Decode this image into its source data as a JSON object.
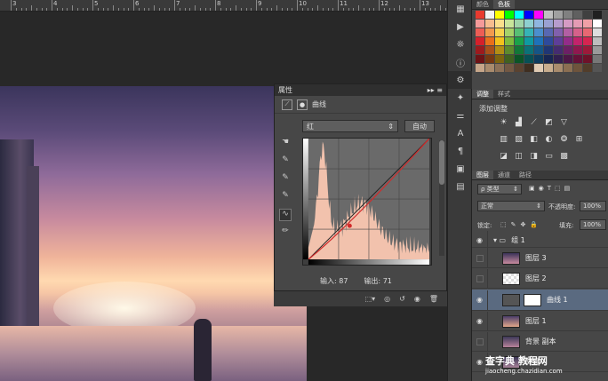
{
  "ruler": {
    "numbers": [
      "3",
      "4",
      "5",
      "6",
      "7",
      "8",
      "9",
      "10",
      "11",
      "12",
      "13"
    ]
  },
  "properties_panel": {
    "title": "属性",
    "subtitle": "曲线",
    "preset_value": "红",
    "auto_label": "自动",
    "input_label": "输入:",
    "input_value": "87",
    "output_label": "输出:",
    "output_value": "71"
  },
  "curve": {
    "channel_color": "#d22a2a",
    "point": {
      "input": 87,
      "output": 71
    }
  },
  "swatch_panel": {
    "tabs": [
      "颜色",
      "色板"
    ],
    "active_tab": "色板",
    "colors": [
      "#e83a2f",
      "#f2f2f2",
      "#ffff00",
      "#00ff00",
      "#00ffff",
      "#0000ff",
      "#ff00ff",
      "#c0c0c0",
      "#a0a0a0",
      "#808080",
      "#606060",
      "#404040",
      "#202020",
      "#f59a9a",
      "#f7bd8f",
      "#fbe08c",
      "#c9e59a",
      "#9fd3a9",
      "#8ecfd0",
      "#8fb6e0",
      "#9aa1d2",
      "#b79ccd",
      "#d59bc4",
      "#e59bb4",
      "#f0a0a6",
      "#ffffff",
      "#ed5d55",
      "#f29a4e",
      "#f9d44f",
      "#a6d26a",
      "#57bf74",
      "#36b3b6",
      "#4b8fcd",
      "#5868b2",
      "#8160ad",
      "#b25fa3",
      "#d6618a",
      "#e96872",
      "#dedede",
      "#d5202b",
      "#e96f1b",
      "#f4c21c",
      "#7fbb3e",
      "#1aa24a",
      "#0f9aa1",
      "#1e72b9",
      "#2e4a9b",
      "#5e3e98",
      "#932c89",
      "#c2236b",
      "#d62550",
      "#bdbdbd",
      "#9d1a1e",
      "#a9501a",
      "#b38e15",
      "#5d8a2d",
      "#127738",
      "#0b7278",
      "#155586",
      "#203674",
      "#452c70",
      "#6c2065",
      "#8f184f",
      "#9d1a3a",
      "#9a9a9a",
      "#6e1316",
      "#773812",
      "#7e640f",
      "#416120",
      "#0c5427",
      "#075055",
      "#0e3c5f",
      "#172653",
      "#311f50",
      "#4d1747",
      "#651138",
      "#6e1229",
      "#777777",
      "#c6a68a",
      "#a98b6d",
      "#8d7158",
      "#735843",
      "#5a4230",
      "#3f2e20",
      "#e0cbb3",
      "#c8ad8e",
      "#a98c6d",
      "#8b6f52",
      "#6e543c",
      "#523d2a",
      "#555555"
    ]
  },
  "adjustments_panel": {
    "tabs": [
      "调整",
      "样式"
    ],
    "active_tab": "调整",
    "title": "添加调整",
    "row1_icons": [
      "brightness-icon",
      "levels-icon",
      "curves-icon",
      "exposure-icon",
      "triangle-icon"
    ],
    "row2_icons": [
      "vibrance-icon",
      "hue-icon",
      "balance-icon",
      "bw-icon",
      "photo-filter-icon",
      "mixer-icon",
      "lookup-icon"
    ],
    "row3_icons": [
      "invert-icon",
      "posterize-icon",
      "threshold-icon",
      "gradient-map-icon",
      "selective-color-icon"
    ]
  },
  "layers_panel": {
    "tabs": [
      "图层",
      "通道",
      "路径"
    ],
    "active_tab": "图层",
    "kind_filter": "ρ 类型",
    "blend_mode": "正常",
    "opacity_label": "不透明度:",
    "opacity_value": "100%",
    "lock_label": "锁定:",
    "fill_label": "填充:",
    "fill_value": "100%",
    "layers": [
      {
        "name": "组 1",
        "type": "group",
        "visible": true
      },
      {
        "name": "图层 3",
        "type": "pixel",
        "visible": false
      },
      {
        "name": "图层 2",
        "type": "pixel",
        "visible": false
      },
      {
        "name": "曲线 1",
        "type": "adjustment",
        "visible": true,
        "selected": true
      },
      {
        "name": "图层 1",
        "type": "pixel",
        "visible": true
      },
      {
        "name": "背景 副本",
        "type": "pixel",
        "visible": false
      },
      {
        "name": "背景",
        "type": "pixel",
        "visible": true
      }
    ]
  },
  "watermark": {
    "text": "查字典 教程网",
    "url": "jiaocheng.chazidian.com"
  }
}
